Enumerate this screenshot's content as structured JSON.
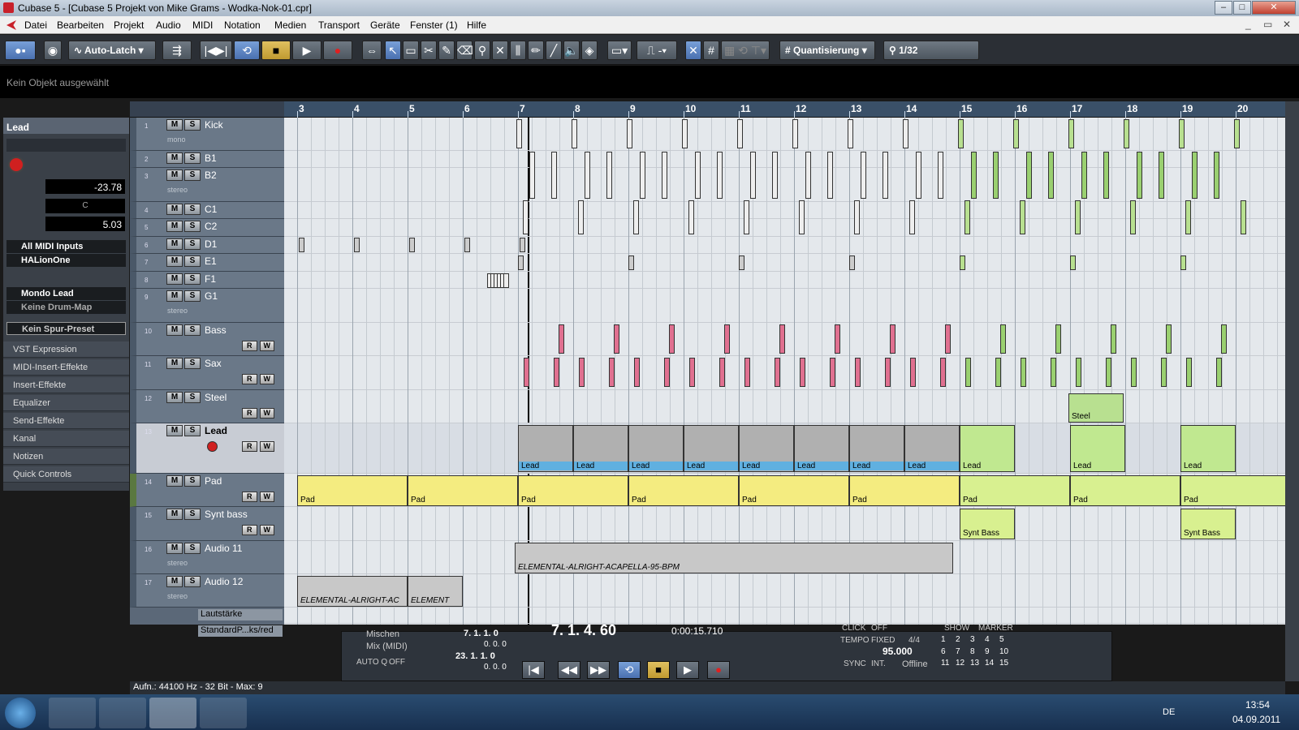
{
  "window": {
    "title": "Cubase 5 - [Cubase 5 Projekt von Mike Grams - Wodka-Nok-01.cpr]"
  },
  "menu": [
    "Datei",
    "Bearbeiten",
    "Projekt",
    "Audio",
    "MIDI",
    "Notation",
    "Medien",
    "Transport",
    "Geräte",
    "Fenster (1)",
    "Hilfe"
  ],
  "toolbar": {
    "automation_mode": "Auto-Latch",
    "quantize_label": "Quantisierung",
    "quantize_value": "1/32"
  },
  "infoline": "Kein Objekt ausgewählt",
  "inspector": {
    "track_name": "Lead",
    "volume": "-23.78",
    "pan": "C",
    "transpose": "5.03",
    "midi_input": "All MIDI Inputs",
    "midi_output": "HALionOne",
    "program": "Mondo Lead",
    "drum_map": "Keine Drum-Map",
    "preset": "Kein Spur-Preset",
    "sections": [
      "VST Expression",
      "MIDI-Insert-Effekte",
      "Insert-Effekte",
      "Equalizer",
      "Send-Effekte",
      "Kanal",
      "Notizen",
      "Quick Controls"
    ]
  },
  "ruler": {
    "bars": [
      "3",
      "4",
      "5",
      "6",
      "7",
      "8",
      "9",
      "10",
      "11",
      "12",
      "13",
      "14",
      "15",
      "16",
      "17",
      "18",
      "19",
      "20"
    ]
  },
  "tracks": [
    {
      "num": "1",
      "name": "Kick",
      "sub": "mono"
    },
    {
      "num": "2",
      "name": "B1",
      "sub": ""
    },
    {
      "num": "3",
      "name": "B2",
      "sub": "stereo"
    },
    {
      "num": "4",
      "name": "C1",
      "sub": ""
    },
    {
      "num": "5",
      "name": "C2",
      "sub": ""
    },
    {
      "num": "6",
      "name": "D1",
      "sub": ""
    },
    {
      "num": "7",
      "name": "E1",
      "sub": ""
    },
    {
      "num": "8",
      "name": "F1",
      "sub": ""
    },
    {
      "num": "9",
      "name": "G1",
      "sub": "stereo"
    },
    {
      "num": "10",
      "name": "Bass",
      "sub": ""
    },
    {
      "num": "11",
      "name": "Sax",
      "sub": ""
    },
    {
      "num": "12",
      "name": "Steel",
      "sub": ""
    },
    {
      "num": "13",
      "name": "Lead",
      "sub": ""
    },
    {
      "num": "14",
      "name": "Pad",
      "sub": ""
    },
    {
      "num": "15",
      "name": "Synt bass",
      "sub": ""
    },
    {
      "num": "16",
      "name": "Audio 11",
      "sub": "stereo"
    },
    {
      "num": "17",
      "name": "Audio 12",
      "sub": "stereo"
    }
  ],
  "automation": [
    "Lautstärke",
    "StandardP...ks/red"
  ],
  "ms_labels": {
    "mute": "M",
    "solo": "S",
    "read": "R",
    "write": "W"
  },
  "parts": {
    "lead": "Lead",
    "pad": "Pad",
    "steel": "Steel",
    "synt_bass": "Synt Bass",
    "audio1": "ELEMENTAL-ALRIGHT-ACAPELLA-95-BPM",
    "audio2a": "ELEMENTAL-ALRIGHT-AC",
    "audio2b": "ELEMENT"
  },
  "transport": {
    "mix_label": "Mischen",
    "mix_midi": "Mix (MIDI)",
    "autoq": "AUTO Q",
    "autoq_val": "OFF",
    "left_locator": "7. 1. 1. 0",
    "right_locator": "23. 1. 1. 0",
    "pos_zero1": "0. 0. 0",
    "pos_zero2": "0. 0. 0",
    "position": "7. 1. 4. 60",
    "time": "0:00:15.710",
    "click": "CLICK",
    "click_val": "OFF",
    "tempo": "TEMPO",
    "tempo_mode": "FIXED",
    "signature": "4/4",
    "tempo_val": "95.000",
    "sync": "SYNC",
    "sync_int": "INT.",
    "sync_val": "Offline",
    "show": "SHOW",
    "marker": "MARKER",
    "markers": [
      "1",
      "2",
      "3",
      "4",
      "5",
      "6",
      "7",
      "8",
      "9",
      "10",
      "11",
      "12",
      "13",
      "14",
      "15"
    ]
  },
  "status": "Aufn.: 44100 Hz - 32 Bit - Max: 9",
  "taskbar": {
    "lang": "DE",
    "time": "13:54",
    "date": "04.09.2011"
  }
}
